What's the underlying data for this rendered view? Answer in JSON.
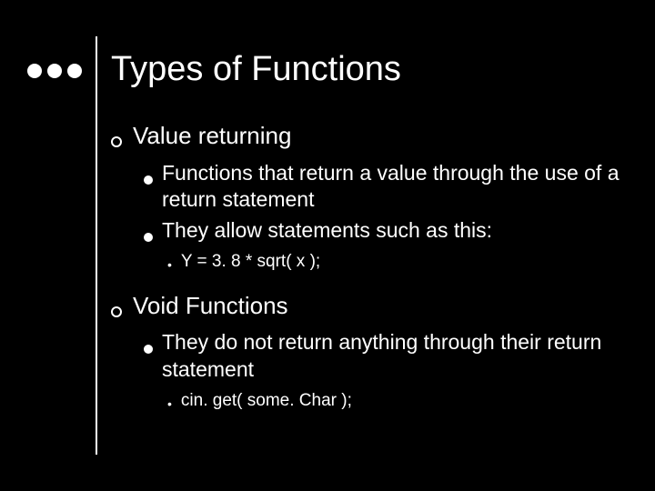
{
  "title": "Types of Functions",
  "sections": [
    {
      "heading": "Value returning",
      "bullets": [
        {
          "text": "Functions that return a value through the use of a return statement"
        },
        {
          "text": "They allow statements such as this:",
          "sub": [
            "Y = 3. 8 * sqrt( x );"
          ]
        }
      ]
    },
    {
      "heading": "Void Functions",
      "bullets": [
        {
          "text": "They do not return anything through their return statement",
          "sub": [
            "cin. get( some. Char );"
          ]
        }
      ]
    }
  ]
}
